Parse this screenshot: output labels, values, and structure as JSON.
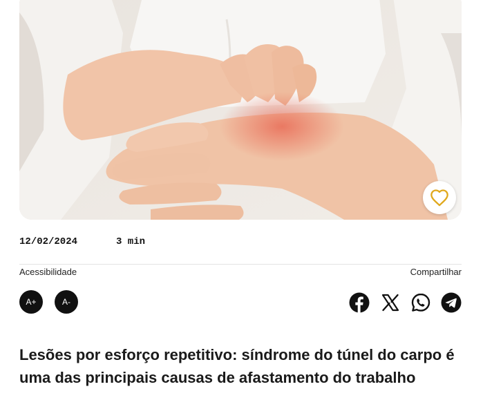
{
  "article": {
    "date": "12/02/2024",
    "read_time": "3 min",
    "title": "Lesões por esforço repetitivo: síndrome do túnel do carpo é uma das principais causas de afastamento do trabalho"
  },
  "hero_image": {
    "icon": "heart-icon",
    "accent_color": "#e0a81c"
  },
  "accessibility": {
    "label": "Acessibilidade",
    "increase": "A+",
    "decrease": "A-"
  },
  "share": {
    "label": "Compartilhar",
    "networks": [
      "facebook-icon",
      "x-icon",
      "whatsapp-icon",
      "telegram-icon"
    ]
  }
}
